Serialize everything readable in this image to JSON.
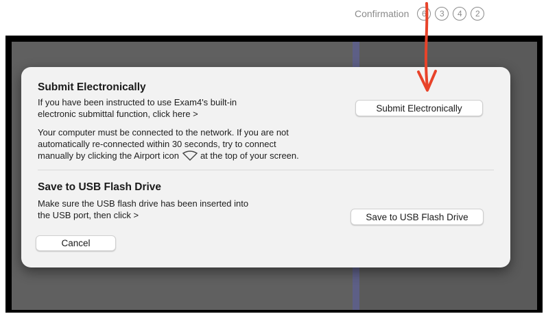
{
  "background": {
    "confirmation_label": "Confirmation",
    "steps": [
      "6",
      "3",
      "4",
      "2"
    ]
  },
  "dialog": {
    "submit_section": {
      "title": "Submit Electronically",
      "instruction_line1": "If you have been instructed to use Exam4's built-in",
      "instruction_line2": "electronic submittal function, click here >",
      "button_label": "Submit Electronically",
      "network_note_line1": "Your computer must be connected to the network. If you are not",
      "network_note_line2": "automatically re-connected within 30 seconds, try to connect",
      "network_note_line3a": "manually by clicking the Airport icon",
      "network_note_line3b": "at the top of your screen.",
      "icon": "wifi-icon"
    },
    "usb_section": {
      "title": "Save to USB Flash Drive",
      "instruction_line1": "Make sure the USB flash drive has been inserted into",
      "instruction_line2": "the USB port, then click >",
      "button_label": "Save to USB Flash Drive"
    },
    "cancel_label": "Cancel"
  },
  "annotation": {
    "arrow_color": "#e8432a",
    "icon": "arrow-down-icon"
  },
  "colors": {
    "dialog_bg": "#f2f2f2",
    "backdrop": "#5e5e5e",
    "divider_accent": "#5d5f86"
  }
}
